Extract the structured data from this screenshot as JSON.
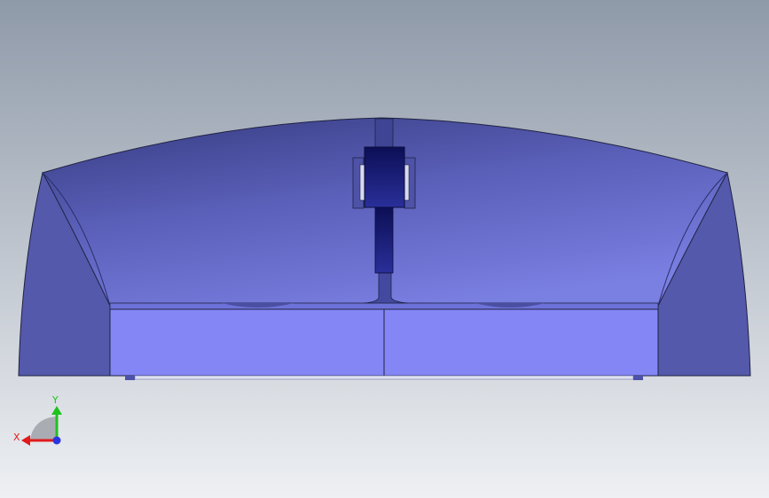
{
  "viewport": {
    "background_top": "#8f9aa9",
    "background_bottom": "#eef0f3"
  },
  "model": {
    "shell_dark": "#3a3f86",
    "shell_mid": "#5a5fb8",
    "shell_light": "#7a7fe2",
    "base_face": "#8386f4",
    "side_face": "#5459ab",
    "roller_color": "#151a6e",
    "edge_color": "#1f2242"
  },
  "triad": {
    "x_label": "X",
    "y_label": "Y",
    "x_color": "#e01b1b",
    "y_color": "#1ec21e",
    "z_color": "#2a35e0"
  }
}
